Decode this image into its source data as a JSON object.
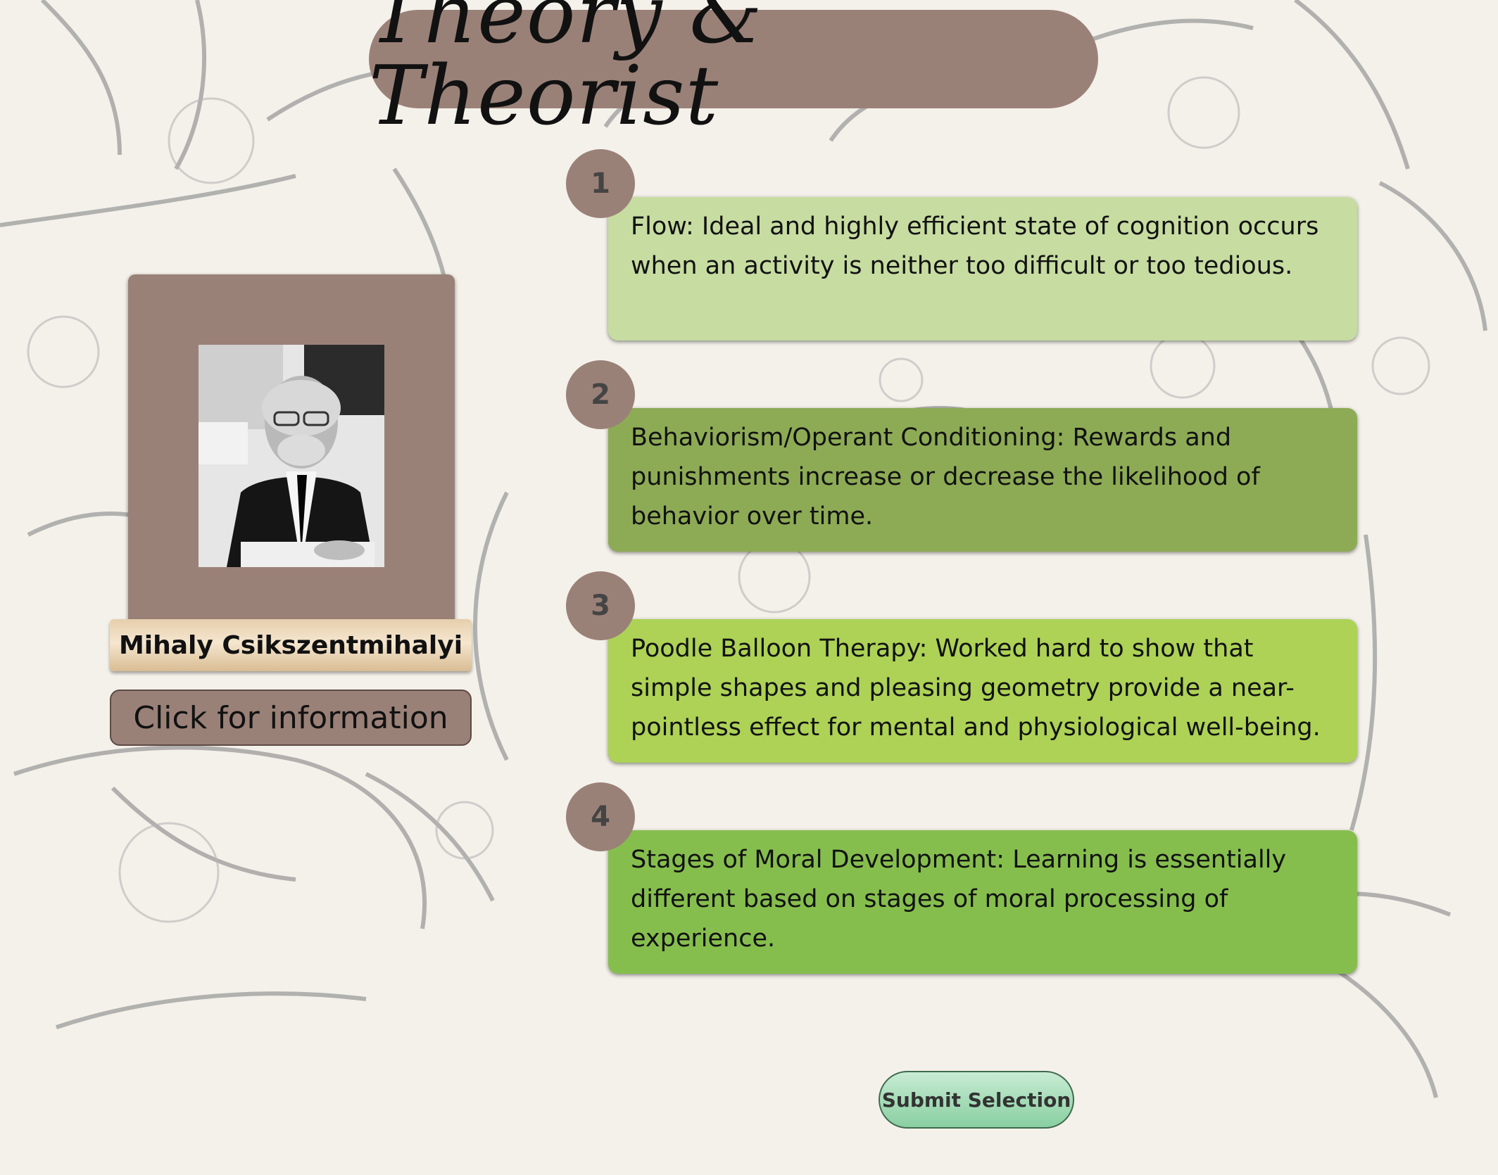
{
  "title": "Theory & Theorist",
  "theorist": {
    "name": "Mihaly Csikszentmihalyi",
    "info_button_label": "Click for information"
  },
  "options": [
    {
      "number": "1",
      "text": "Flow: Ideal and highly efficient state of cognition occurs when an activity is neither too difficult or too tedious.",
      "color": "#c7dca1"
    },
    {
      "number": "2",
      "text": "Behaviorism/Operant Conditioning: Rewards and punishments increase or decrease the likelihood of behavior over time.",
      "color": "#8dab55"
    },
    {
      "number": "3",
      "text": "Poodle Balloon Therapy: Worked hard to show that simple shapes and pleasing geometry provide a near-pointless effect for mental and physiological well-being.",
      "color": "#add256"
    },
    {
      "number": "4",
      "text": "Stages of Moral Development: Learning is essentially different based on stages of moral processing of experience.",
      "color": "#86be4e"
    }
  ],
  "submit_label": "Submit Selection",
  "colors": {
    "panel_brown": "#9a8178",
    "background": "#f4f1ea"
  }
}
